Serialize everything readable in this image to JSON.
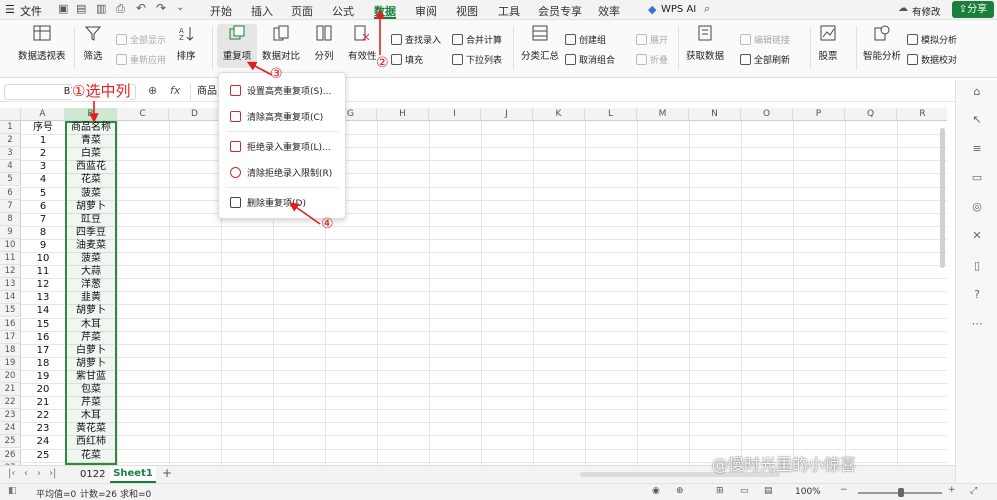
{
  "menubar": {
    "file_label": "文件",
    "tabs": [
      "开始",
      "插入",
      "页面",
      "公式",
      "数据",
      "审阅",
      "视图",
      "工具",
      "会员专享",
      "效率"
    ],
    "active_tab": "数据",
    "wps_ai": "WPS AI",
    "modified_label": "有修改",
    "share_label": "分享"
  },
  "ribbon": {
    "pivot": "数据透视表",
    "filter": "筛选",
    "show_all": "全部显示",
    "reapply": "重新应用",
    "sort": "排序",
    "duplicates": "重复项",
    "compare": "数据对比",
    "split": "分列",
    "validity": "有效性",
    "find_input": "查找录入",
    "fill": "填充",
    "consolidate": "合并计算",
    "dropdown_list": "下拉列表",
    "subtotal": "分类汇总",
    "create_group": "创建组",
    "ungroup": "取消组合",
    "expand": "展开",
    "collapse": "折叠",
    "get_data": "获取数据",
    "edit_links": "编辑链接",
    "refresh_all": "全部刷新",
    "stocks": "股票",
    "smart_analysis": "智能分析",
    "what_if": "模拟分析",
    "data_check": "数据校对"
  },
  "formula_bar": {
    "cell_ref": "B1",
    "fx": "fx",
    "content": "商品"
  },
  "dropdown_menu": [
    "设置高亮重复项(S)...",
    "清除高亮重复项(C)",
    "拒绝录入重复项(L)...",
    "清除拒绝录入限制(R)",
    "删除重复项(D)"
  ],
  "annotations": {
    "step1": "①选中列",
    "step2": "②",
    "step3": "③",
    "step4": "④"
  },
  "columns": [
    "A",
    "B",
    "C",
    "D",
    "E",
    "F",
    "G",
    "H",
    "I",
    "J",
    "K",
    "L",
    "M",
    "N",
    "O",
    "P",
    "Q",
    "R"
  ],
  "header_row": {
    "a": "序号",
    "b": "商品名称"
  },
  "rows": [
    {
      "n": "1",
      "name": "青菜"
    },
    {
      "n": "2",
      "name": "白菜"
    },
    {
      "n": "3",
      "name": "西蓝花"
    },
    {
      "n": "4",
      "name": "花菜"
    },
    {
      "n": "5",
      "name": "菠菜"
    },
    {
      "n": "6",
      "name": "胡萝卜"
    },
    {
      "n": "7",
      "name": "豇豆"
    },
    {
      "n": "8",
      "name": "四季豆"
    },
    {
      "n": "9",
      "name": "油麦菜"
    },
    {
      "n": "10",
      "name": "菠菜"
    },
    {
      "n": "11",
      "name": "大蒜"
    },
    {
      "n": "12",
      "name": "洋葱"
    },
    {
      "n": "13",
      "name": "韭黄"
    },
    {
      "n": "14",
      "name": "胡萝卜"
    },
    {
      "n": "15",
      "name": "木耳"
    },
    {
      "n": "16",
      "name": "芹菜"
    },
    {
      "n": "17",
      "name": "白萝卜"
    },
    {
      "n": "18",
      "name": "胡萝卜"
    },
    {
      "n": "19",
      "name": "紫甘蓝"
    },
    {
      "n": "20",
      "name": "包菜"
    },
    {
      "n": "21",
      "name": "芹菜"
    },
    {
      "n": "22",
      "name": "木耳"
    },
    {
      "n": "23",
      "name": "黄花菜"
    },
    {
      "n": "24",
      "name": "西红柿"
    },
    {
      "n": "25",
      "name": "花菜"
    }
  ],
  "sheets": {
    "tab1": "0122",
    "tab2": "Sheet1"
  },
  "status": {
    "average": "平均值=0",
    "count": "计数=26",
    "sum": "求和=0",
    "zoom": "100%"
  },
  "watermark": "@慢时光里的小惊喜",
  "colors": {
    "accent": "#1a7f3c",
    "annotation_red": "#e02020",
    "selection": "#2e8b3e"
  }
}
